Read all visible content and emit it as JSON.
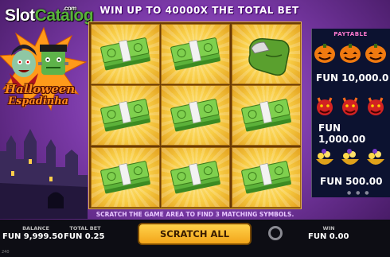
{
  "watermark": {
    "part1": "Slot",
    "part2": "Catalog",
    "part3": ".com"
  },
  "headline": "WIN UP TO 40000X THE TOTAL BET",
  "logo": {
    "line1": "Halloween",
    "line2": "Espadinha"
  },
  "grid": {
    "cells": [
      "money",
      "money",
      "thumb",
      "money",
      "money",
      "money",
      "money",
      "money",
      "money"
    ]
  },
  "paytable": {
    "title": "PAYTABLE",
    "rows": [
      {
        "symbol": "pumpkin",
        "value": "FUN 10,000.0"
      },
      {
        "symbol": "devil",
        "value": "FUN 1,000.00"
      },
      {
        "symbol": "gold",
        "value": "FUN 500.00"
      }
    ]
  },
  "instruction": "SCRATCH THE GAME AREA TO FIND 3 MATCHING SYMBOLS.",
  "footer": {
    "balance_label": "BALANCE",
    "balance_value": "FUN 9,999.50",
    "total_bet_label": "TOTAL BET",
    "total_bet_value": "FUN 0.25",
    "scratch_all_label": "SCRATCH ALL",
    "win_label": "WIN",
    "win_value": "FUN 0.00",
    "corner_text": "240"
  }
}
